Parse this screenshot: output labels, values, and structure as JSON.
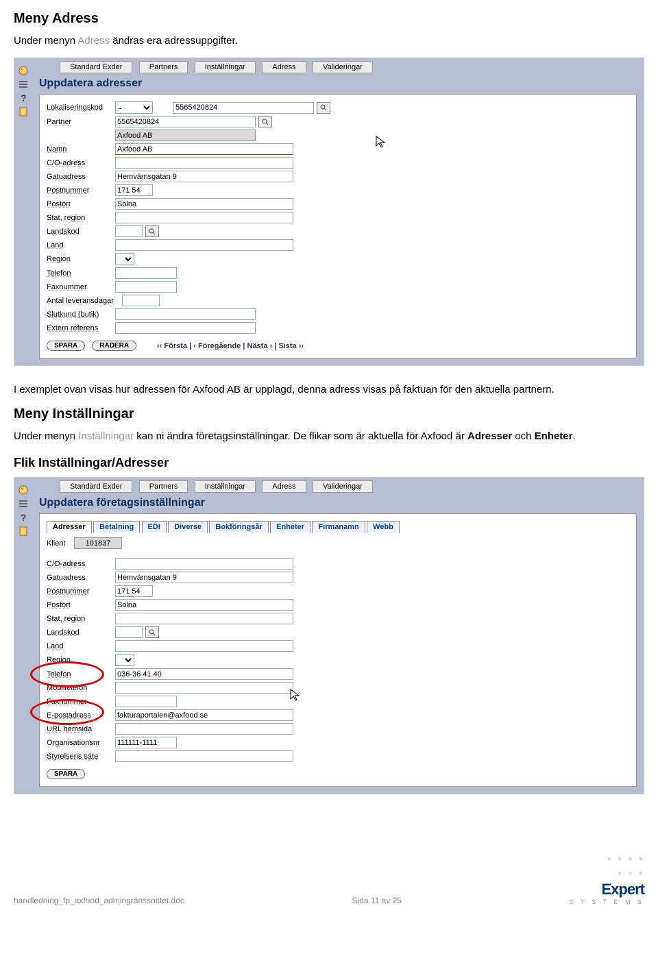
{
  "doc": {
    "h1": "Meny Adress",
    "intro_pre": "Under menyn ",
    "intro_adr": "Adress",
    "intro_post": " ändras era adressuppgifter.",
    "para1": "I exemplet ovan visas hur adressen för Axfood AB är upplagd, denna adress visas på faktuan för den aktuella partnern.",
    "h2": "Meny Inställningar",
    "para2_pre": "Under menyn ",
    "para2_inst": "Inställningar",
    "para2_mid": " kan ni ändra företagsinställningar. De flikar som är aktuella för Axfood är ",
    "para2_b1": "Adresser",
    "para2_and": " och ",
    "para2_b2": "Enheter",
    "para2_end": ".",
    "h3": "Flik Inställningar/Adresser"
  },
  "tabs_outer": [
    "Standard Exder",
    "Partners",
    "Inställningar",
    "Adress",
    "Valideringar"
  ],
  "app1": {
    "title": "Uppdatera adresser",
    "fields": {
      "lokaliseringskod": "Lokaliseringskod",
      "lok_val": "-",
      "lok_code": "5565420824",
      "partner": "Partner",
      "partner_val": "5565420824",
      "partner_name": "Axfood AB",
      "namn": "Namn",
      "namn_val": "Axfood AB",
      "co": "C/O-adress",
      "gatu": "Gatuadress",
      "gatu_val": "Hemvärnsgatan 9",
      "postnr": "Postnummer",
      "postnr_val": "171 54",
      "postort": "Postort",
      "postort_val": "Solna",
      "stat": "Stat, region",
      "landskod": "Landskod",
      "land": "Land",
      "region": "Region",
      "telefon": "Telefon",
      "fax": "Faxnummer",
      "leverans": "Antal leveransdagar",
      "slutkund": "Slutkund (butik)",
      "externref": "Extern referens"
    },
    "buttons": {
      "spara": "SPARA",
      "radera": "RADERA"
    },
    "pager": "‹‹ Första | ‹ Föregående | Nästa › | Sista ››"
  },
  "app2": {
    "title": "Uppdatera företagsinställningar",
    "subtabs": [
      "Adresser",
      "Betalning",
      "EDI",
      "Diverse",
      "Bokföringsår",
      "Enheter",
      "Firmanamn",
      "Webb"
    ],
    "klient_label": "Klient",
    "klient_val": "101837",
    "fields": {
      "co": "C/O-adress",
      "gatu": "Gatuadress",
      "gatu_val": "Hemvärnsgatan 9",
      "postnr": "Postnummer",
      "postnr_val": "171 54",
      "postort": "Postort",
      "postort_val": "Solna",
      "stat": "Stat, region",
      "landskod": "Landskod",
      "land": "Land",
      "region": "Region",
      "telefon": "Telefon",
      "telefon_val": "036-36 41 40",
      "mobil": "Mobiltelefon",
      "fax": "Faxnummer",
      "epost": "E-postadress",
      "epost_val": "fakturaportalen@axfood.se",
      "url": "URL hemsida",
      "orgnr": "Organisationsnr",
      "orgnr_val": "111111-1111",
      "styrelsen": "Styrelsens säte"
    },
    "buttons": {
      "spara": "SPARA"
    }
  },
  "footer": {
    "file": "handledning_fp_axfood_admingränssnittet.doc",
    "page": "Sida 11 av 25",
    "logo_name": "Expert",
    "logo_sub": "S Y S T E M S"
  }
}
